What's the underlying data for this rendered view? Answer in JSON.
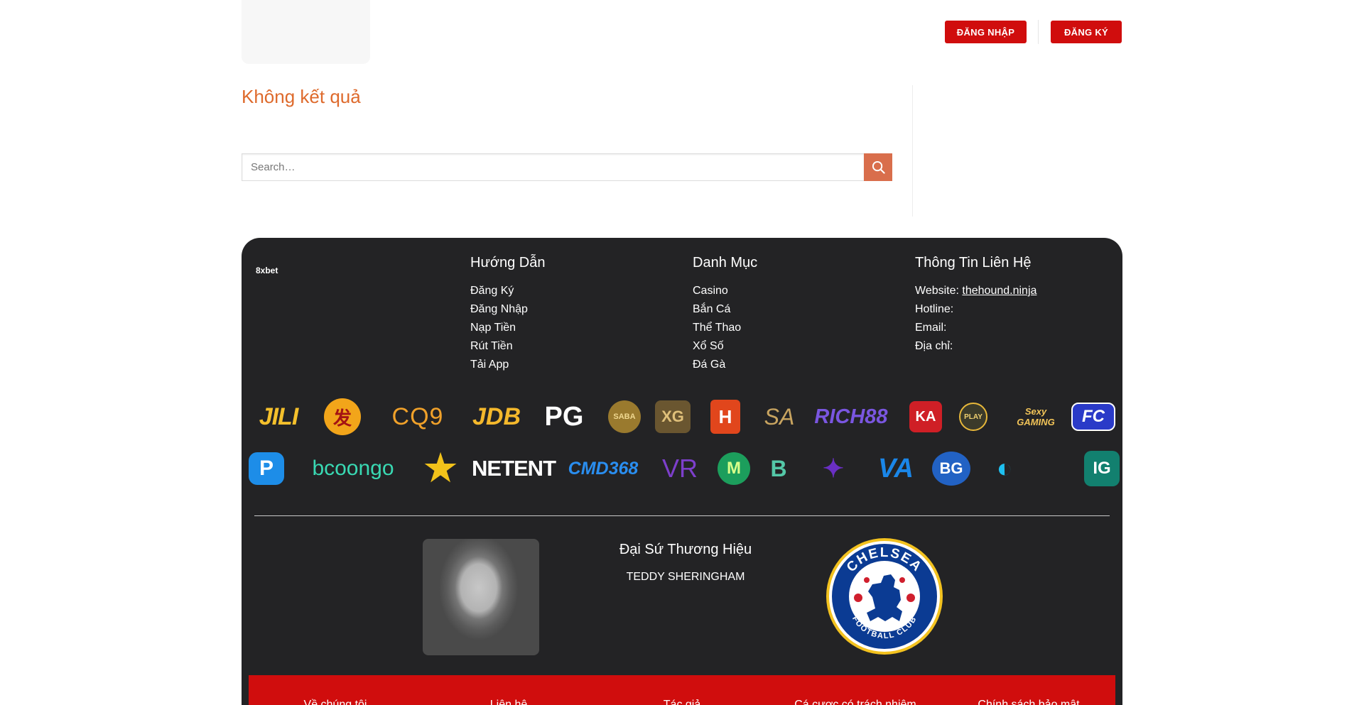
{
  "header": {
    "login_label": "ĐĂNG NHẬP",
    "register_label": "ĐĂNG KÝ"
  },
  "main": {
    "title": "Không kết quả",
    "search_placeholder": "Search…"
  },
  "footer": {
    "brand": "8xbet",
    "columns": [
      {
        "heading": "Hướng Dẫn",
        "items": [
          "Đăng Ký",
          "Đăng Nhập",
          "Nạp Tiền",
          "Rút Tiền",
          "Tải App"
        ]
      },
      {
        "heading": "Danh Mục",
        "items": [
          "Casino",
          "Bắn Cá",
          "Thể Thao",
          "Xổ Số",
          "Đá Gà"
        ]
      },
      {
        "heading": "Thông Tin Liên Hệ",
        "website_label": "Website:",
        "website_link": "thehound.ninja",
        "hotline_label": "Hotline:",
        "email_label": "Email:",
        "address_label": "Địa chỉ:"
      }
    ],
    "providers_row1": [
      "JILI",
      "发",
      "CQ9",
      "JDB",
      "PG",
      "SABA",
      "XG",
      "H",
      "SA",
      "RICH88",
      "KA",
      "PLAY",
      "Sexy GAMING",
      "FC"
    ],
    "providers_row2": [
      "P",
      "bcoongo",
      "★",
      "NETENT",
      "CMD368",
      "VR",
      "M",
      "B",
      "✦",
      "VA",
      "BG",
      "◐",
      "IG"
    ],
    "ambassador": {
      "title": "Đại Sứ Thương Hiệu",
      "name": "TEDDY SHERINGHAM",
      "club_text_top": "CHELSEA",
      "club_text_bottom": "FOOTBALL CLUB"
    },
    "bottom_links": [
      "Về chúng tôi",
      "Liên hệ",
      "Tác giả",
      "Cá cược có trách nhiệm",
      "Chính sách bảo mật"
    ]
  },
  "colors": {
    "primary_red": "#d00d0d",
    "title_orange": "#de6a2c",
    "search_button": "#d96e4c",
    "footer_bg": "#232325"
  }
}
